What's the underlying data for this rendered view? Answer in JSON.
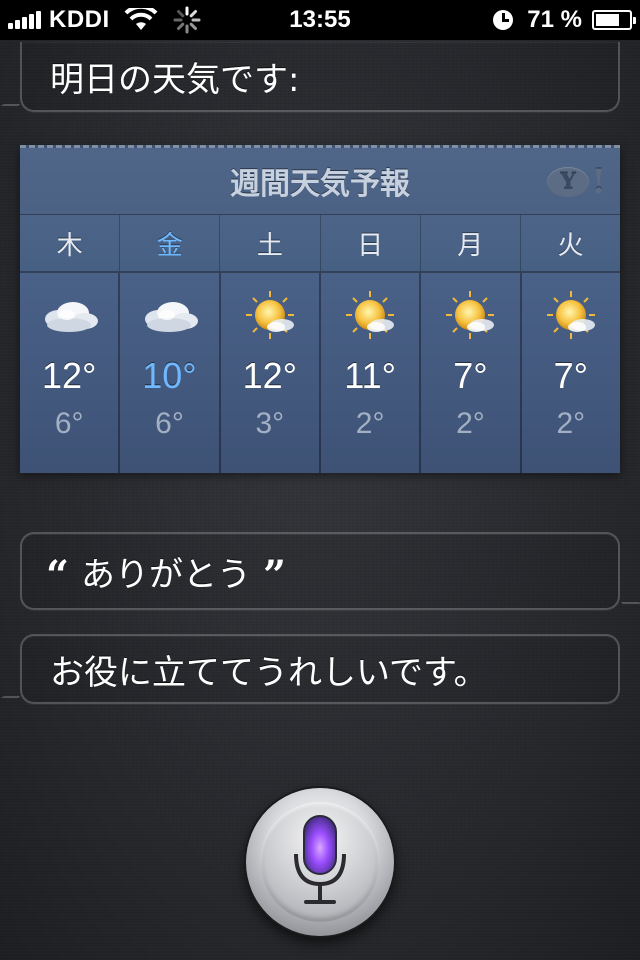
{
  "status_bar": {
    "carrier": "KDDI",
    "time": "13:55",
    "battery": "71 %",
    "battery_level": 0.71
  },
  "conversation": {
    "siri_reply_1": "明日の天気です:",
    "user_utterance": "ありがとう",
    "quote_open": "“",
    "quote_close": "”",
    "siri_reply_2": "お役に立ててうれしいです。"
  },
  "weather": {
    "title": "週間天気予報",
    "provider_logo": "Y",
    "provider_logo_bang": "!",
    "days": [
      {
        "label": "木",
        "icon": "cloudy-icon",
        "high": "12°",
        "low": "6°",
        "highlight": false
      },
      {
        "label": "金",
        "icon": "cloudy-icon",
        "high": "10°",
        "low": "6°",
        "highlight": true
      },
      {
        "label": "土",
        "icon": "sun-cloud-icon",
        "high": "12°",
        "low": "3°",
        "highlight": false
      },
      {
        "label": "日",
        "icon": "sun-cloud-icon",
        "high": "11°",
        "low": "2°",
        "highlight": false
      },
      {
        "label": "月",
        "icon": "sun-cloud-icon",
        "high": "7°",
        "low": "2°",
        "highlight": false
      },
      {
        "label": "火",
        "icon": "sun-cloud-icon",
        "high": "7°",
        "low": "2°",
        "highlight": false
      }
    ]
  },
  "colors": {
    "highlight": "#6fb8ff",
    "card_bg": "#4a6188",
    "mic_glow": "#9b4dff"
  }
}
